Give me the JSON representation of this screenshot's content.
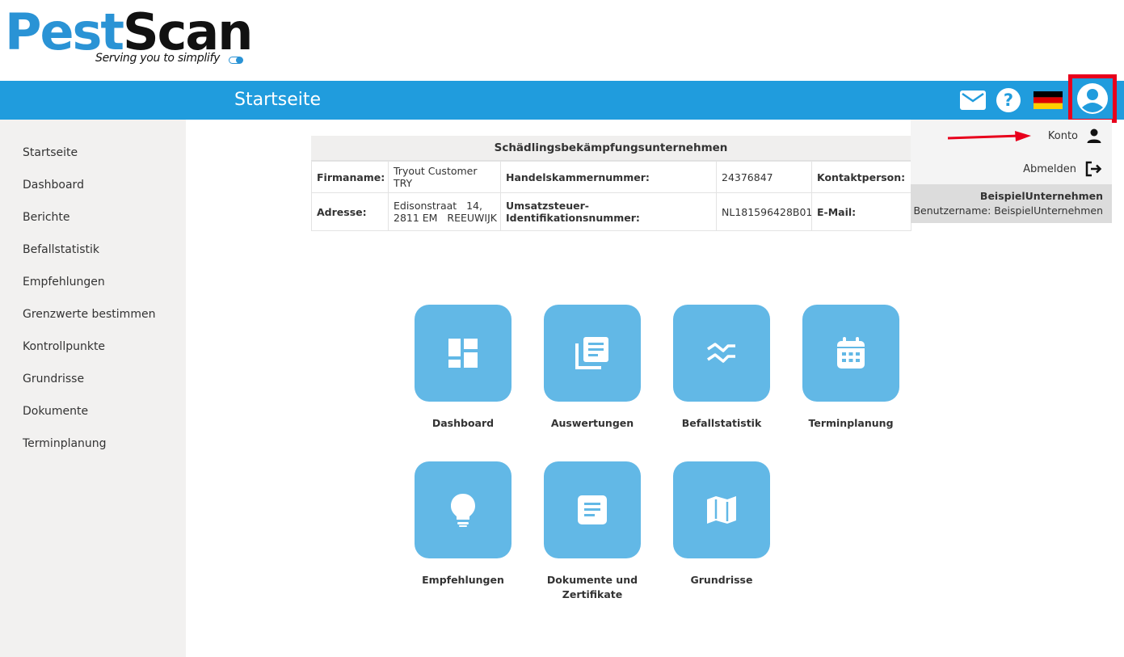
{
  "brand": {
    "name_part1": "Pest",
    "name_part2": "Scan",
    "tagline": "Serving you to simplify"
  },
  "header": {
    "title": "Startseite",
    "icons": [
      "mail-icon",
      "help-icon",
      "flag-de-icon",
      "user-account-icon"
    ]
  },
  "sidebar": {
    "items": [
      {
        "label": "Startseite"
      },
      {
        "label": "Dashboard"
      },
      {
        "label": "Berichte"
      },
      {
        "label": "Befallstatistik"
      },
      {
        "label": "Empfehlungen"
      },
      {
        "label": "Grenzwerte bestimmen"
      },
      {
        "label": "Kontrollpunkte"
      },
      {
        "label": "Grundrisse"
      },
      {
        "label": "Dokumente"
      },
      {
        "label": "Terminplanung"
      }
    ]
  },
  "company": {
    "title": "Schädlingsbekämpfungsunternehmen",
    "firmaname_label": "Firmaname:",
    "firmaname_value": "Tryout Customer TRY",
    "kvk_label": "Handelskammernummer:",
    "kvk_value": "24376847",
    "contact_label": "Kontaktperson:",
    "contact_value": "",
    "address_label": "Adresse:",
    "address_line1": "Edisonstraat   14,",
    "address_line2": "2811 EM   REEUWIJK",
    "vat_label": "Umsatzsteuer-Identifikationsnummer:",
    "vat_value": "NL181596428B01",
    "email_label": "E-Mail:",
    "email_value": ""
  },
  "tiles": [
    {
      "label": "Dashboard",
      "icon": "dashboard-icon"
    },
    {
      "label": "Auswertungen",
      "icon": "library-books-icon"
    },
    {
      "label": "Befallstatistik",
      "icon": "multiline-chart-icon"
    },
    {
      "label": "Terminplanung",
      "icon": "calendar-icon"
    },
    {
      "label": "Empfehlungen",
      "icon": "lightbulb-icon"
    },
    {
      "label": "Dokumente und Zertifikate",
      "icon": "document-icon"
    },
    {
      "label": "Grundrisse",
      "icon": "map-icon"
    }
  ],
  "account_menu": {
    "konto_label": "Konto",
    "logout_label": "Abmelden",
    "company_name": "BeispielUnternehmen",
    "username_line": "Benutzername: BeispielUnternehmen"
  },
  "colors": {
    "header_blue": "#209cdd",
    "tile_blue": "#62b8e6",
    "highlight_red": "#e8001c",
    "sidebar_bg": "#f2f1f0"
  }
}
